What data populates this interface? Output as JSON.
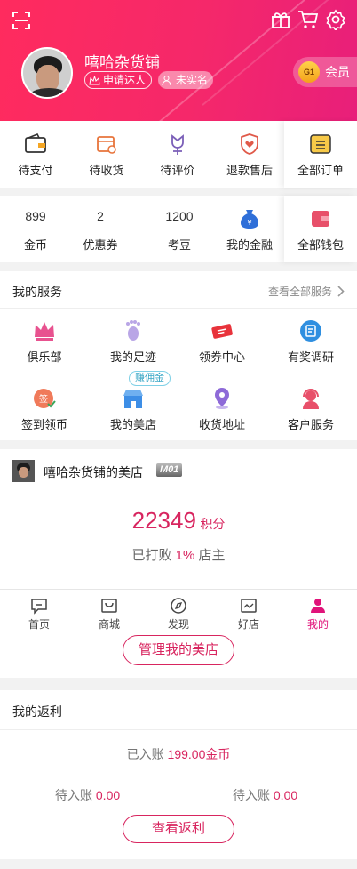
{
  "header": {
    "shop_name": "嘻哈杂货铺",
    "apply_tag": "申请达人",
    "realname_tag": "未实名",
    "member_badge": "G1",
    "member_label": "会员",
    "icons": [
      "scan-icon",
      "gift-icon",
      "cart-icon",
      "gear-icon"
    ]
  },
  "orders": {
    "items": [
      {
        "label": "待支付",
        "icon": "wallet-icon"
      },
      {
        "label": "待收货",
        "icon": "package-icon"
      },
      {
        "label": "待评价",
        "icon": "flower-icon"
      },
      {
        "label": "退款售后",
        "icon": "heart-shield-icon"
      }
    ],
    "all_label": "全部订单"
  },
  "wallet": {
    "items": [
      {
        "value": "899",
        "label": "金币"
      },
      {
        "value": "2",
        "label": "优惠券"
      },
      {
        "value": "1200",
        "label": "考豆"
      },
      {
        "value": "",
        "label": "我的金融"
      }
    ],
    "all_label": "全部钱包"
  },
  "services": {
    "title": "我的服务",
    "more": "查看全部服务",
    "items": [
      {
        "label": "俱乐部",
        "icon": "crown-icon"
      },
      {
        "label": "我的足迹",
        "icon": "footprint-icon"
      },
      {
        "label": "领券中心",
        "icon": "ticket-icon"
      },
      {
        "label": "有奖调研",
        "icon": "survey-icon"
      },
      {
        "label": "签到领币",
        "icon": "checkin-icon"
      },
      {
        "label": "我的美店",
        "icon": "store-icon"
      },
      {
        "label": "收货地址",
        "icon": "location-icon"
      },
      {
        "label": "客户服务",
        "icon": "headset-icon"
      }
    ],
    "earn_badge": "赚佣金"
  },
  "store": {
    "name": "嘻哈杂货铺的美店",
    "level_badge": "M01",
    "score": "22349",
    "score_unit": "积分",
    "beat_prefix": "已打败",
    "beat_percent": "1%",
    "beat_suffix": "店主",
    "manage_button": "管理我的美店"
  },
  "rebate": {
    "title": "我的返利",
    "credited_prefix": "已入账",
    "credited_value": "199.00金币",
    "pending_label": "待入账",
    "pending_left": "0.00",
    "pending_right": "0.00",
    "view_button": "查看返利"
  },
  "tabbar": {
    "tabs": [
      {
        "label": "首页",
        "icon": "chat-icon"
      },
      {
        "label": "商城",
        "icon": "bag-icon"
      },
      {
        "label": "发现",
        "icon": "compass-icon"
      },
      {
        "label": "好店",
        "icon": "shop-icon"
      },
      {
        "label": "我的",
        "icon": "person-icon"
      }
    ],
    "active_color": "#e0137a"
  },
  "colors": {
    "brand": "#f5286a",
    "accent": "#d8255f"
  }
}
